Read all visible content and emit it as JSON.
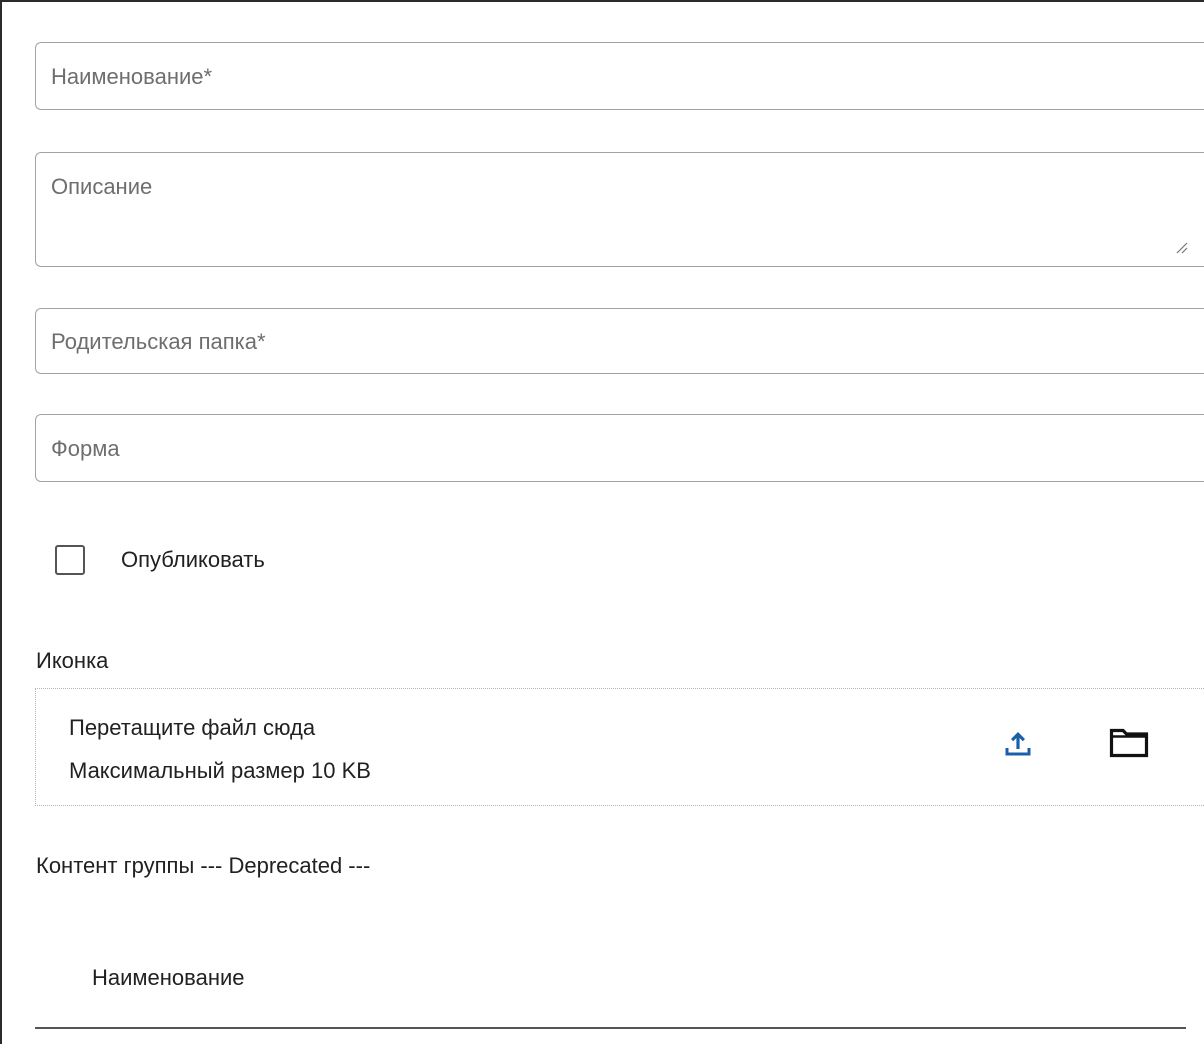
{
  "form": {
    "name_field": {
      "placeholder": "Наименование*",
      "value": ""
    },
    "description_field": {
      "placeholder": "Описание",
      "value": ""
    },
    "parent_folder_field": {
      "placeholder": "Родительская папка*",
      "value": ""
    },
    "form_field": {
      "placeholder": "Форма",
      "value": ""
    },
    "publish_checkbox": {
      "label": "Опубликовать",
      "checked": false
    }
  },
  "icon_upload": {
    "section_label": "Иконка",
    "drop_text": "Перетащите файл сюда",
    "max_size_text": "Максимальный размер 10 KB",
    "icons": {
      "upload": "upload-icon",
      "browse": "folder-icon"
    },
    "accent_color": "#1a5fa8"
  },
  "group_content": {
    "section_label": "Контент группы --- Deprecated ---",
    "table": {
      "columns": [
        "Наименование"
      ]
    }
  }
}
